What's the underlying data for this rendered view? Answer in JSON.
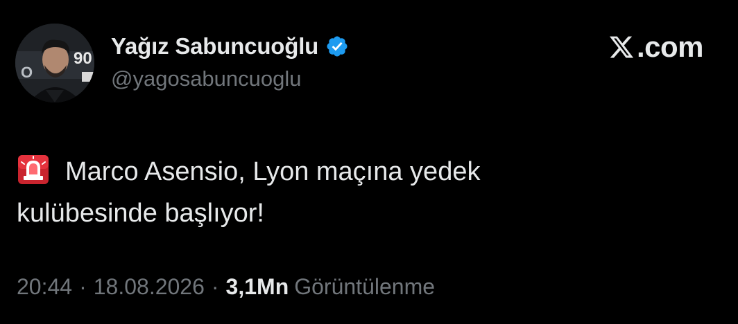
{
  "tweet": {
    "author": {
      "display_name": "Yağız Sabuncuoğlu",
      "handle": "@yagosabuncuoglu",
      "verified": true,
      "avatar_icon": "profile-photo"
    },
    "brand": {
      "text": ".com",
      "icon": "x-logo-icon"
    },
    "body": {
      "emoji_icon": "rotating-light-siren",
      "line1": "Marco Asensio, Lyon maçına yedek",
      "line2": "kulübesinde başlıyor!"
    },
    "meta": {
      "time": "20:44",
      "separator": "·",
      "date": "18.08.2026",
      "views_count": "3,1Mn",
      "views_label": "Görüntülenme"
    }
  },
  "colors": {
    "background": "#000000",
    "primary_text": "#e7e9ea",
    "secondary_text": "#71767b",
    "verified_badge": "#1d9bf0",
    "siren_red": "#e5323d"
  }
}
